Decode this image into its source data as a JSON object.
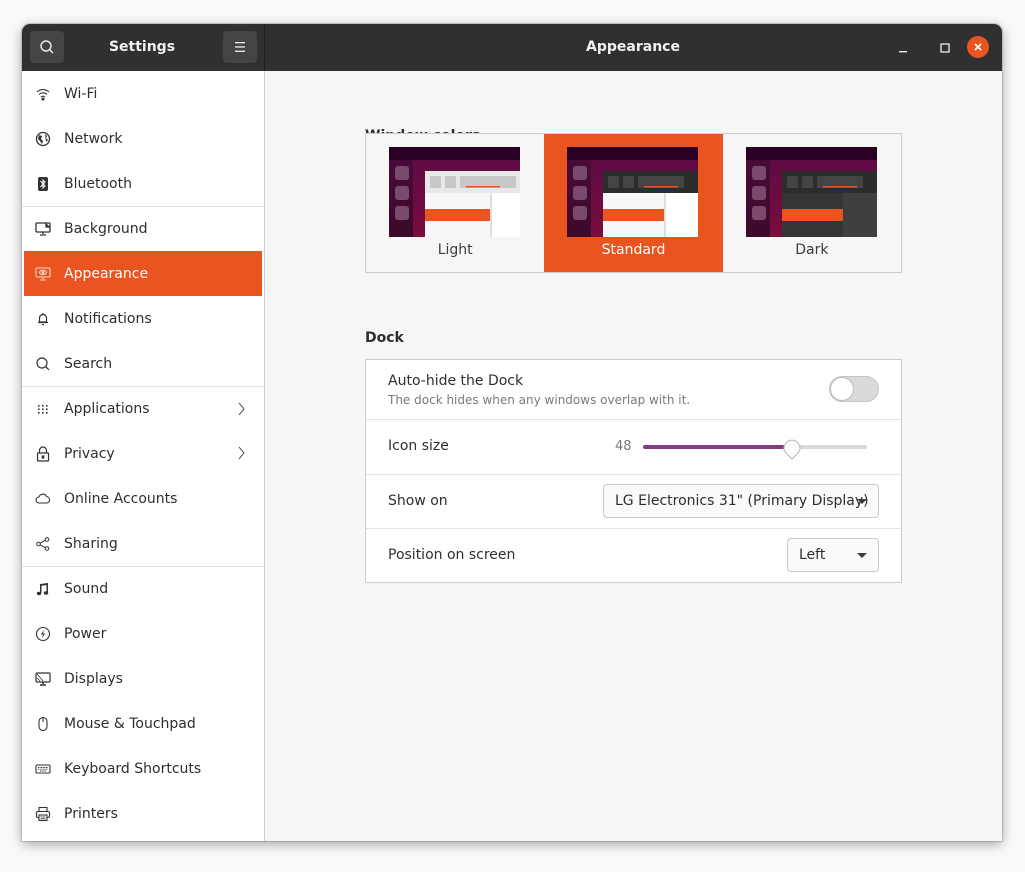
{
  "headerbar": {
    "app_title": "Settings",
    "page_title": "Appearance",
    "search_icon": "search-icon",
    "menu_icon": "hamburger-menu-icon",
    "window_controls": [
      "minimize-icon",
      "maximize-icon",
      "close-icon"
    ]
  },
  "sidebar": {
    "items": [
      {
        "label": "Wi-Fi",
        "icon": "wifi-icon"
      },
      {
        "label": "Network",
        "icon": "globe-icon"
      },
      {
        "label": "Bluetooth",
        "icon": "bluetooth-icon"
      },
      {
        "label": "Background",
        "icon": "background-icon"
      },
      {
        "label": "Appearance",
        "icon": "appearance-icon",
        "active": true
      },
      {
        "label": "Notifications",
        "icon": "bell-icon"
      },
      {
        "label": "Search",
        "icon": "search-icon"
      },
      {
        "label": "Applications",
        "icon": "grid-icon",
        "has_submenu": true
      },
      {
        "label": "Privacy",
        "icon": "lock-icon",
        "has_submenu": true
      },
      {
        "label": "Online Accounts",
        "icon": "cloud-icon"
      },
      {
        "label": "Sharing",
        "icon": "share-icon"
      },
      {
        "label": "Sound",
        "icon": "music-note-icon"
      },
      {
        "label": "Power",
        "icon": "power-icon"
      },
      {
        "label": "Displays",
        "icon": "display-icon"
      },
      {
        "label": "Mouse & Touchpad",
        "icon": "mouse-icon"
      },
      {
        "label": "Keyboard Shortcuts",
        "icon": "keyboard-icon"
      },
      {
        "label": "Printers",
        "icon": "printer-icon"
      }
    ]
  },
  "window_colors": {
    "title": "Window colors",
    "options": [
      {
        "label": "Light",
        "selected": false
      },
      {
        "label": "Standard",
        "selected": true
      },
      {
        "label": "Dark",
        "selected": false
      }
    ]
  },
  "dock": {
    "title": "Dock",
    "autohide": {
      "label": "Auto-hide the Dock",
      "sublabel": "The dock hides when any windows overlap with it.",
      "enabled": false
    },
    "icon_size": {
      "label": "Icon size",
      "value": "48",
      "min": 16,
      "max": 64,
      "current": 48
    },
    "show_on": {
      "label": "Show on",
      "value": "LG Electronics 31\" (Primary Display)"
    },
    "position": {
      "label": "Position on screen",
      "value": "Left"
    }
  },
  "colors": {
    "accent": "#e95420",
    "headerbar": "#303030",
    "slider_fill": "#843d7f"
  }
}
